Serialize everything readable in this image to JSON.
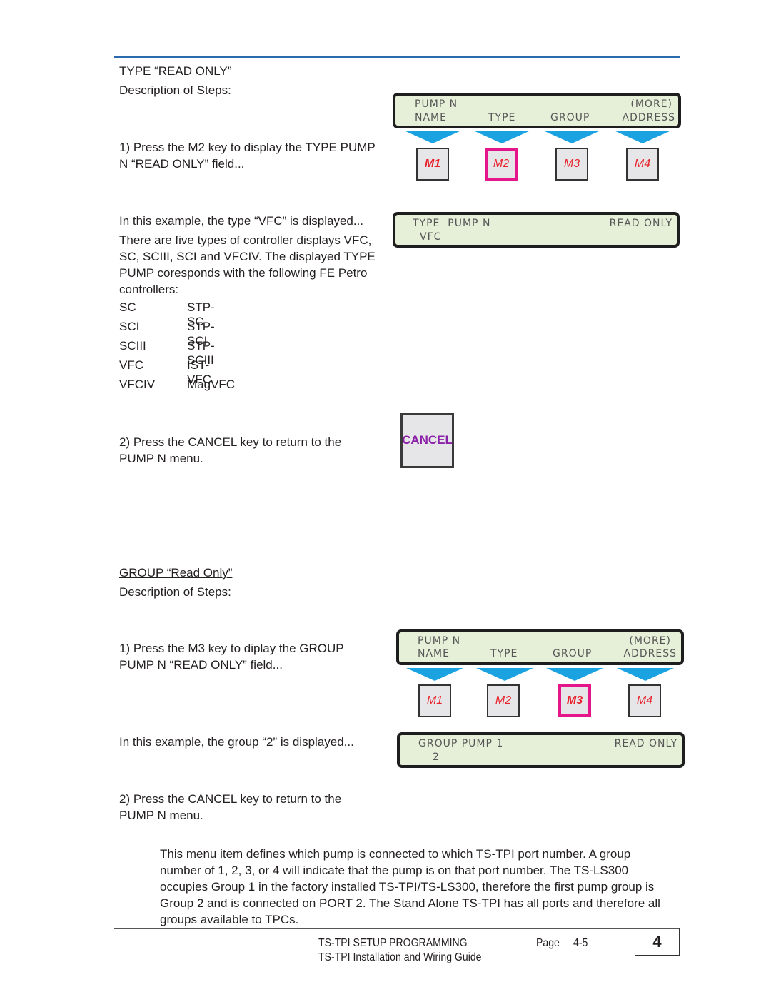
{
  "type_section": {
    "heading": "TYPE “READ ONLY”",
    "desc_label": "Description of Steps:",
    "step1_line1": "1) Press the M2 key to display the TYPE PUMP",
    "step1_line2": "N “READ ONLY” field...",
    "example": "In this example, the type “VFC” is displayed...",
    "para_lines": [
      "There are five types of controller displays VFC,",
      "SC, SCIII, SCI and VFCIV. The displayed TYPE",
      "PUMP coresponds with the following FE Petro",
      "controllers:"
    ],
    "controllers": [
      {
        "type": "SC",
        "controller": "STP-SC"
      },
      {
        "type": "SCI",
        "controller": "STP-SCI"
      },
      {
        "type": "SCIII",
        "controller": "STP-SCIII"
      },
      {
        "type": "VFC",
        "controller": "IST-VFC"
      },
      {
        "type": "VFCIV",
        "controller": "MagVFC"
      }
    ],
    "step2_line1": "2) Press the CANCEL key to return to the",
    "step2_line2": "PUMP N menu.",
    "menu_lcd": {
      "title": "PUMP N",
      "more": "(MORE)",
      "options": [
        "NAME",
        "TYPE",
        "GROUP",
        "ADDRESS"
      ]
    },
    "keys": [
      "M1",
      "M2",
      "M3",
      "M4"
    ],
    "selected_key": "M2",
    "result_lcd": {
      "line1_left": "TYPE  PUMP N",
      "line1_right": "READ ONLY",
      "line2": "VFC"
    },
    "cancel_key": "CANCEL"
  },
  "group_section": {
    "heading": "GROUP “Read Only”",
    "desc_label": "Description of Steps:",
    "step1_line1": "1) Press the M3 key to diplay the GROUP",
    "step1_line2": "PUMP N “READ ONLY” field...",
    "example": "In this example, the group “2” is displayed...",
    "step2_line1": "2) Press the CANCEL key to return to the",
    "step2_line2": "PUMP N menu.",
    "menu_lcd": {
      "title": "PUMP N",
      "more": "(MORE)",
      "options": [
        "NAME",
        "TYPE",
        "GROUP",
        "ADDRESS"
      ]
    },
    "keys": [
      "M1",
      "M2",
      "M3",
      "M4"
    ],
    "selected_key": "M3",
    "result_lcd": {
      "line1_left": "GROUP PUMP 1",
      "line1_right": "READ ONLY",
      "line2": "2"
    }
  },
  "note_lines": [
    "This menu item defines which pump is connected to which TS-TPI port number. A group",
    "number of 1, 2, 3, or 4 will indicate that the pump is on that port number.  The TS-LS300",
    "occupies Group 1 in the factory installed TS-TPI/TS-LS300, therefore the first pump group is",
    "Group 2 and is connected on PORT 2.  The Stand Alone TS-TPI has all ports and therefore all",
    "groups available to TPCs."
  ],
  "footer": {
    "section_title": "TS-TPI SETUP PROGRAMMING",
    "guide_title": "TS-TPI Installation and Wiring Guide",
    "page_label": "Page",
    "page_number": "4-5",
    "chapter": "4"
  }
}
